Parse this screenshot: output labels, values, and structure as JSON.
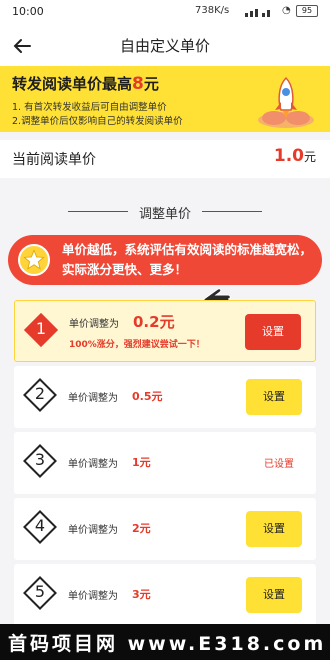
{
  "statusbar": {
    "time": "10:00",
    "net": "738K/s",
    "battery": "95"
  },
  "nav": {
    "title": "自由定义单价"
  },
  "banner": {
    "headline_prefix": "转发阅读单价最高",
    "headline_num": "8",
    "headline_suffix": "元",
    "line1": "1. 有首次转发收益后可自由调整单价",
    "line2": "2.调整单价后仅影响自己的转发阅读单价"
  },
  "current": {
    "label": "当前阅读单价",
    "value": "1.0",
    "unit": "元"
  },
  "section": {
    "title": "调整单价"
  },
  "tip": {
    "text": "单价越低，系统评估有效阅读的标准越宽松，实际涨分更快、更多！"
  },
  "options": [
    {
      "num": "1",
      "label": "单价调整为",
      "price": "0.2元",
      "sub": "100%涨分，强烈建议尝试一下！",
      "button": "设置"
    },
    {
      "num": "2",
      "label": "单价调整为",
      "price": "0.5元",
      "button": "设置"
    },
    {
      "num": "3",
      "label": "单价调整为",
      "price": "1元",
      "status": "已设置"
    },
    {
      "num": "4",
      "label": "单价调整为",
      "price": "2元",
      "button": "设置"
    },
    {
      "num": "5",
      "label": "单价调整为",
      "price": "3元",
      "button": "设置"
    }
  ],
  "watermark": {
    "text": "首码项目网 www.E318.com"
  }
}
